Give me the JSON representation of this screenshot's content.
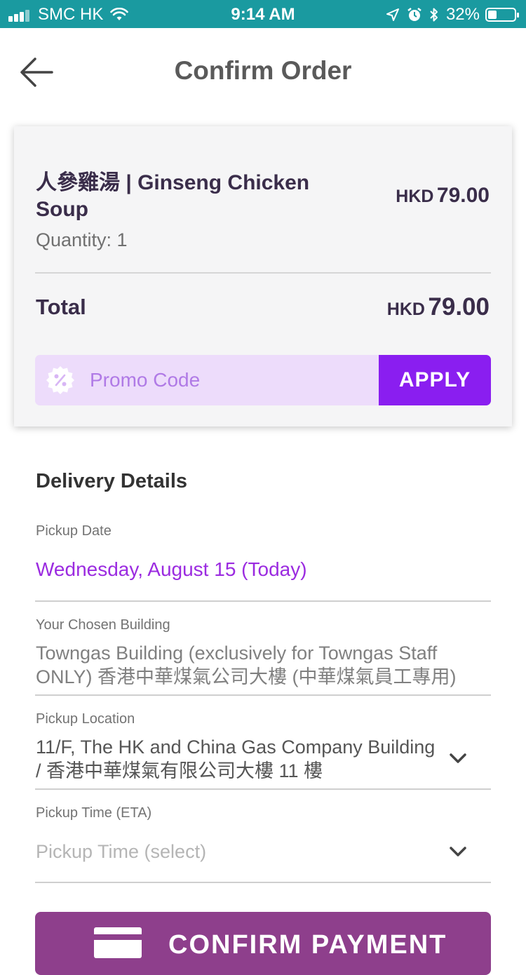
{
  "status_bar": {
    "carrier": "SMC HK",
    "time": "9:14 AM",
    "battery": "32%",
    "battery_level": 0.32
  },
  "header": {
    "title": "Confirm Order",
    "back_icon": "arrow-left-icon"
  },
  "order": {
    "item_name": "人參雞湯 | Ginseng Chicken Soup",
    "quantity": "Quantity: 1",
    "item_currency": "HKD",
    "item_amount": "79.00",
    "total_label": "Total",
    "total_currency": "HKD",
    "total_amount": "79.00"
  },
  "promo": {
    "placeholder": "Promo Code",
    "value": "",
    "apply_label": "APPLY",
    "icon": "percent-badge-icon"
  },
  "delivery": {
    "title": "Delivery Details",
    "pickup_date_label": "Pickup Date",
    "pickup_date_value": "Wednesday, August 15 (Today)",
    "building_label": "Your Chosen Building",
    "building_value": "Towngas Building (exclusively for Towngas Staff ONLY) 香港中華煤氣公司大樓 (中華煤氣員工專用)",
    "location_label": "Pickup Location",
    "location_value": "11/F, The HK and China Gas Company Building / 香港中華煤氣有限公司大樓 11 樓",
    "time_label": "Pickup Time (ETA)",
    "time_placeholder": "Pickup Time (select)"
  },
  "confirm": {
    "label": "CONFIRM PAYMENT",
    "icon": "credit-card-icon"
  },
  "colors": {
    "status_bar": "#1a9aa0",
    "accent": "#8a1ef0",
    "promo_bg": "#eddcfb",
    "date_text": "#9b2be0",
    "confirm_bg": "#8e3f8c"
  }
}
